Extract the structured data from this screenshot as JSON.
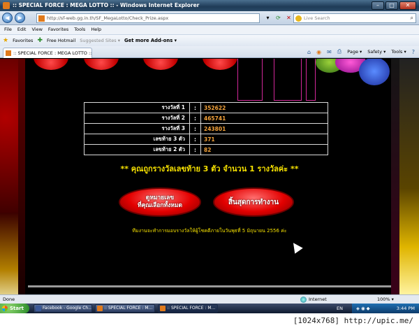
{
  "window": {
    "title": ":: SPECIAL FORCE : MEGA LOTTO :: - Windows Internet Explorer",
    "buttons": {
      "minimize": "–",
      "maximize": "□",
      "close": "✕"
    }
  },
  "address_bar": {
    "url": "http://sf-web.gg.in.th/SF_MegaLotto/Check_Prize.aspx",
    "search_placeholder": "Live Search"
  },
  "menu": [
    "File",
    "Edit",
    "View",
    "Favorites",
    "Tools",
    "Help"
  ],
  "favorites_bar": {
    "favorites": "Favorites",
    "free_hotmail": "Free Hotmail",
    "suggested_sites": "Suggested Sites ▾",
    "get_addons": "Get more Add-ons ▾"
  },
  "tab": {
    "label": ":: SPECIAL FORCE : MEGA LOTTO ::"
  },
  "command_bar": {
    "page": "Page ▾",
    "safety": "Safety ▾",
    "tools": "Tools ▾"
  },
  "results": [
    {
      "label": "รางวัลที่ 1",
      "sep": ":",
      "value": "352622"
    },
    {
      "label": "รางวัลที่ 2",
      "sep": ":",
      "value": "465741"
    },
    {
      "label": "รางวัลที่ 3",
      "sep": ":",
      "value": "243801"
    },
    {
      "label": "เลขท้าย 3 ตัว",
      "sep": ":",
      "value": "371"
    },
    {
      "label": "เลขท้าย 2 ตัว",
      "sep": ":",
      "value": "82"
    }
  ],
  "notice": "** คุณถูกรางวัลเลขท้าย 3 ตัว จำนวน 1 รางวัลค่ะ **",
  "buttons": {
    "view_numbers_line1": "ดูหมายเลข",
    "view_numbers_line2": "ที่คุณเลือกทั้งหมด",
    "finish": "สิ้นสุดการทำงาน"
  },
  "footnote": "ทีมงานจะทำการมอบรางวัลให้ผู้โชคดีภายในวันพุธที่ 5 มิถุนายน 2556 ค่ะ",
  "status_bar": {
    "done": "Done",
    "zone": "Internet",
    "zoom": "100% ▾"
  },
  "taskbar": {
    "start": "Start",
    "items": [
      {
        "label": "Facebook - Google Ch..."
      },
      {
        "label": ":: SPECIAL FORCE : M..."
      },
      {
        "label": ":: SPECIAL FORCE : M..."
      }
    ],
    "lang": "EN",
    "time": "3:44 PM"
  },
  "watermark": "[1024x768] http://upic.me/",
  "colors": {
    "value_orange": "#f3a23a",
    "notice_yellow": "#f5e000",
    "button_red": "#e30000"
  }
}
